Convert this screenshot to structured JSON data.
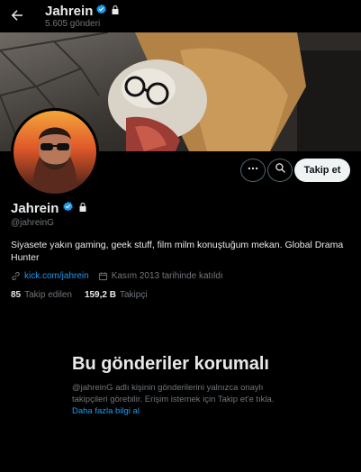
{
  "header": {
    "name": "Jahrein",
    "post_count": "5.605 gönderi"
  },
  "profile": {
    "name": "Jahrein",
    "handle": "@jahreinG",
    "bio": "Siyasete yakın gaming, geek stuff, film milm konuştuğum mekan. Global Drama Hunter",
    "link": "kick.com/jahrein",
    "joined": "Kasım 2013 tarihinde katıldı",
    "following_count": "85",
    "following_label": "Takip edilen",
    "followers_count": "159,2 B",
    "followers_label": "Takipçi"
  },
  "actions": {
    "follow_label": "Takip et"
  },
  "protected": {
    "title": "Bu gönderiler korumalı",
    "description": "@jahreinG adlı kişinin gönderilerini yalnızca onaylı takipçileri görebilir. Erişim istemek için Takip et'e tıkla.",
    "learn_more": "Daha fazla bilgi al"
  },
  "colors": {
    "accent": "#1d9bf0",
    "background": "#000000",
    "text_primary": "#e7e9ea",
    "text_secondary": "#71767b"
  },
  "icons": [
    "back-arrow-icon",
    "verified-badge-icon",
    "lock-icon",
    "more-icon",
    "search-icon",
    "link-icon",
    "calendar-icon"
  ]
}
